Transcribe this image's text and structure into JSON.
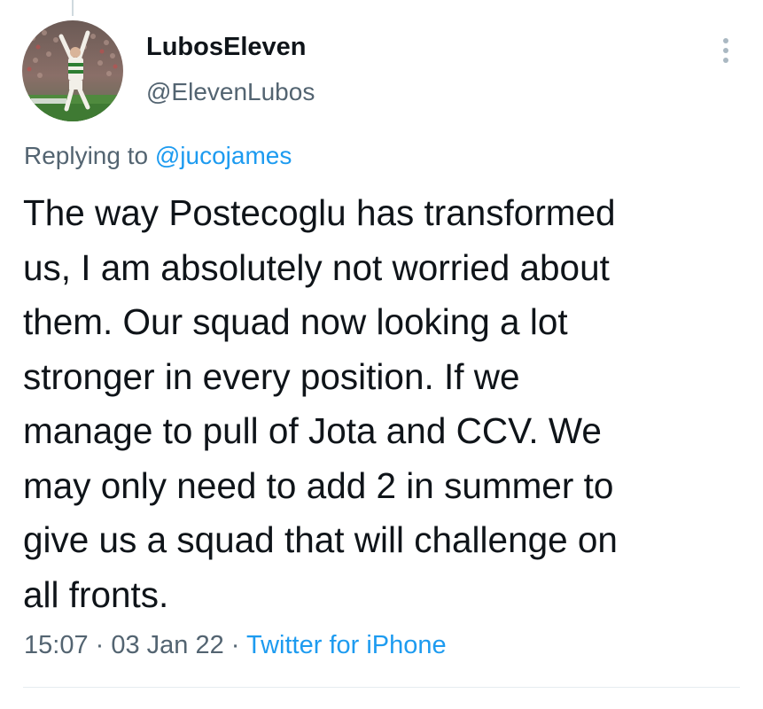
{
  "author": {
    "display_name": "LubosEleven",
    "handle": "@ElevenLubos"
  },
  "reply": {
    "prefix": "Replying to",
    "to": "@jucojames"
  },
  "tweet": {
    "lines": [
      "The way Postecoglu has transformed",
      "us, I am absolutely not worried about",
      "them. Our squad now looking a lot",
      "stronger in every position. If we",
      "manage to pull of Jota and CCV. We",
      "may only need to add 2 in summer to",
      "give us a squad that will challenge on",
      "all fronts."
    ]
  },
  "meta": {
    "time": "15:07",
    "sep1": " · ",
    "date": "03 Jan 22",
    "sep2": " · ",
    "source": "Twitter for iPhone"
  },
  "icons": {
    "more": "more-vertical-icon"
  },
  "colors": {
    "link": "#1d9bf0",
    "secondary_text": "#536471",
    "primary_text": "#0f1419"
  }
}
